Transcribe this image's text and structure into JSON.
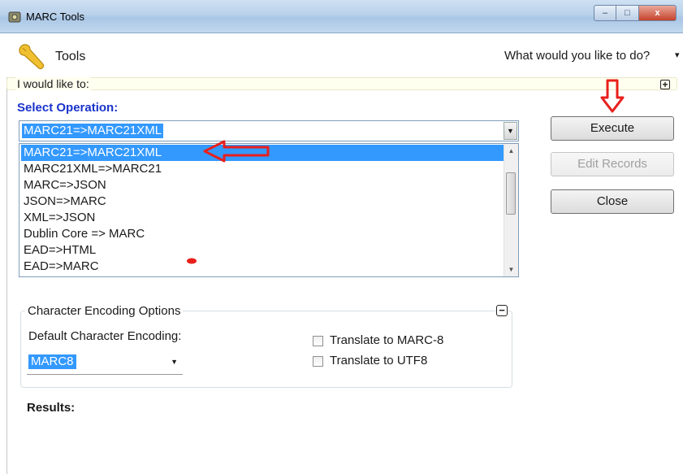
{
  "window": {
    "title": "MARC Tools",
    "minimize": "–",
    "maximize": "□",
    "close": "x"
  },
  "toolbar": {
    "tools_label": "Tools",
    "ask": "What would you like to do?",
    "ask_caret": "▾"
  },
  "section": {
    "would_like": "I would like to:",
    "expand": "+",
    "select_operation": "Select Operation:"
  },
  "operation": {
    "selected": "MARC21=>MARC21XML",
    "options": [
      "MARC21=>MARC21XML",
      "MARC21XML=>MARC21",
      "MARC=>JSON",
      "JSON=>MARC",
      "XML=>JSON",
      "Dublin Core => MARC",
      "EAD=>HTML",
      "EAD=>MARC"
    ]
  },
  "buttons": {
    "execute": "Execute",
    "edit_records": "Edit Records",
    "close": "Close"
  },
  "encoding": {
    "group_title": "Character Encoding Options",
    "collapse": "−",
    "default_label": "Default Character Encoding:",
    "default_value": "MARC8",
    "translate_marc8": "Translate to MARC-8",
    "translate_utf8": "Translate to UTF8"
  },
  "results_label": "Results:",
  "colors": {
    "selection": "#3399ff",
    "select_operation": "#1a33cc",
    "annotation_red": "#e8201c"
  }
}
